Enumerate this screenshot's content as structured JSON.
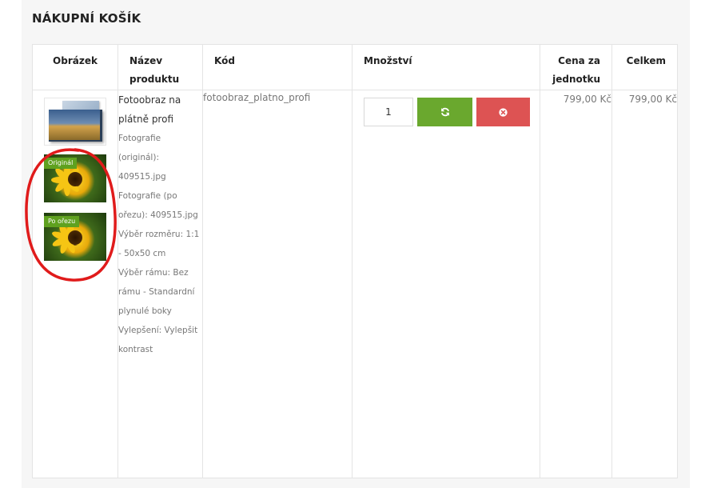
{
  "cart": {
    "title": "NÁKUPNÍ KOŠÍK",
    "columns": {
      "image": "Obrázek",
      "name": "Název produktu",
      "code": "Kód",
      "quantity": "Množství",
      "unit_price": "Cena za jednotku",
      "total": "Celkem"
    },
    "item": {
      "name": "Fotoobraz na plátně profi",
      "attributes": [
        "Fotografie (originál): 409515.jpg",
        "Fotografie (po ořezu): 409515.jpg",
        "Výběr rozměru: 1:1 - 50x50 cm",
        "Výběr rámu: Bez rámu - Standardní plynulé boky",
        "Vylepšení: Vylepšit kontrast"
      ],
      "code": "fotoobraz_platno_profi",
      "quantity": "1",
      "unit_price": "799,00 Kč",
      "total": "799,00 Kč",
      "photos": {
        "original_label": "Originál",
        "cropped_label": "Po ořezu"
      }
    },
    "icons": {
      "update": "refresh-icon",
      "remove": "remove-icon"
    },
    "colors": {
      "update_button": "#6aa82e",
      "remove_button": "#dd5353",
      "badge": "#5fa11f",
      "annotation": "#e01b1b"
    }
  }
}
